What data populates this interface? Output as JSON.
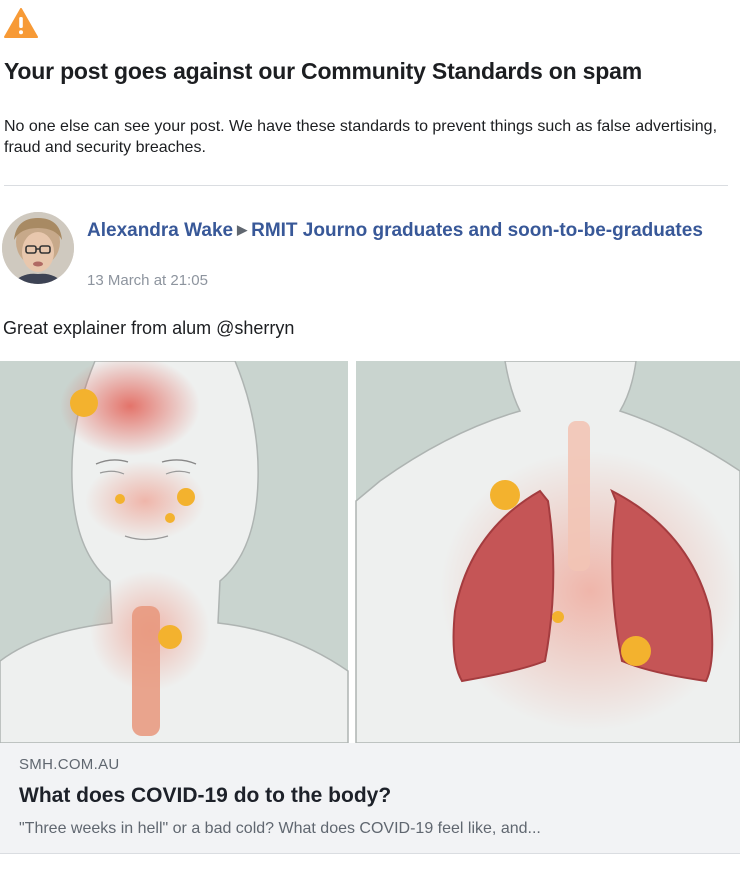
{
  "notice": {
    "icon": "warning-triangle-icon",
    "icon_color": "#f79a36",
    "title": "Your post goes against our Community Standards on spam",
    "body": "No one else can see your post. We have these standards to prevent things such as false advertising, fraud and security breaches."
  },
  "post": {
    "author": "Alexandra Wake",
    "separator_icon": "right-triangle-icon",
    "group": "RMIT Journo graduates and soon-to-be-graduates",
    "timestamp": "13 March at 21:05",
    "text": "Great explainer from alum @sherryn",
    "link_color": "#385898"
  },
  "link_preview": {
    "image": "covid-body-illustration",
    "domain": "SMH.COM.AU",
    "title": "What does COVID-19 do to the body?",
    "description": "\"Three weeks in hell\" or a bad cold? What does COVID-19 feel like, and..."
  }
}
